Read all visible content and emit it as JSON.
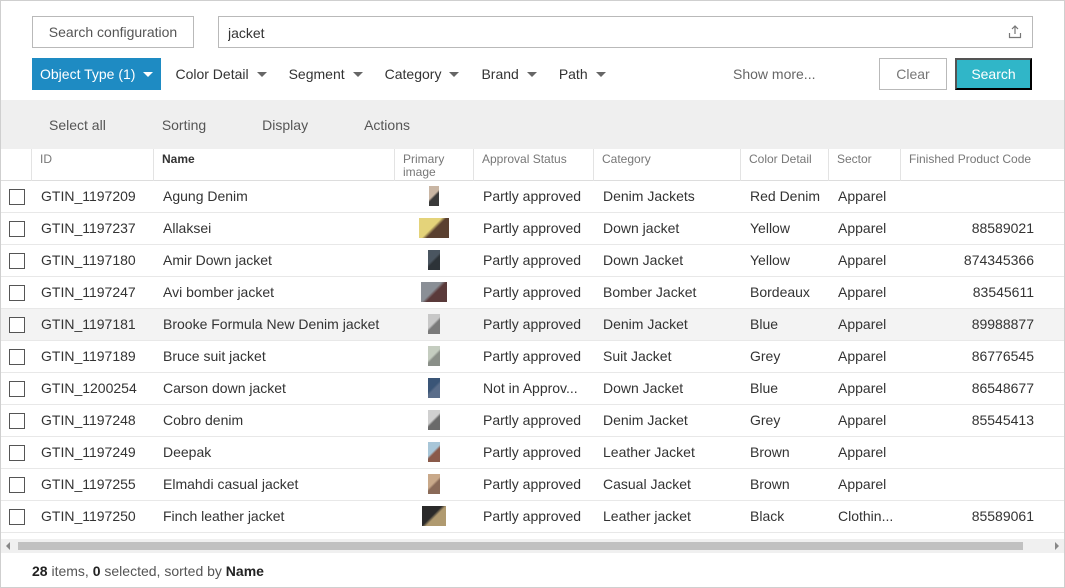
{
  "search": {
    "config_button": "Search configuration",
    "query": "jacket"
  },
  "filters": [
    {
      "label": "Object Type (1)",
      "active": true
    },
    {
      "label": "Color Detail",
      "active": false
    },
    {
      "label": "Segment",
      "active": false
    },
    {
      "label": "Category",
      "active": false
    },
    {
      "label": "Brand",
      "active": false
    },
    {
      "label": "Path",
      "active": false
    }
  ],
  "show_more": "Show more...",
  "clear_label": "Clear",
  "search_label": "Search",
  "toolbar": {
    "select_all": "Select all",
    "sorting": "Sorting",
    "display": "Display",
    "actions": "Actions"
  },
  "columns": [
    "ID",
    "Name",
    "Primary image",
    "Approval Status",
    "Category",
    "Color Detail",
    "Sector",
    "Finished Product Code"
  ],
  "rows": [
    {
      "id": "GTIN_1197209",
      "name": "Agung Denim",
      "status": "Partly approved",
      "category": "Denim Jackets",
      "color": "Red Denim",
      "sector": "Apparel",
      "code": "",
      "img": [
        "#c9b6a4",
        "#3a3a3a"
      ]
    },
    {
      "id": "GTIN_1197237",
      "name": "Allaksei",
      "status": "Partly approved",
      "category": "Down jacket",
      "color": "Yellow",
      "sector": "Apparel",
      "code": "88589021",
      "img": [
        "#e4d37a",
        "#5a4030"
      ]
    },
    {
      "id": "GTIN_1197180",
      "name": "Amir Down jacket",
      "status": "Partly approved",
      "category": "Down Jacket",
      "color": "Yellow",
      "sector": "Apparel",
      "code": "874345366",
      "img": [
        "#4a5560",
        "#2d3338"
      ]
    },
    {
      "id": "GTIN_1197247",
      "name": "Avi bomber jacket",
      "status": "Partly approved",
      "category": "Bomber Jacket",
      "color": "Bordeaux",
      "sector": "Apparel",
      "code": "83545611",
      "img": [
        "#8a8f96",
        "#5a3a3a"
      ]
    },
    {
      "id": "GTIN_1197181",
      "name": "Brooke Formula New Denim jacket",
      "status": "Partly approved",
      "category": "Denim Jacket",
      "color": "Blue",
      "sector": "Apparel",
      "code": "89988877",
      "img": [
        "#c8c8c8",
        "#7a7a7a"
      ]
    },
    {
      "id": "GTIN_1197189",
      "name": "Bruce suit jacket",
      "status": "Partly approved",
      "category": "Suit Jacket",
      "color": "Grey",
      "sector": "Apparel",
      "code": "86776545",
      "img": [
        "#c5cdc0",
        "#8a8f88"
      ]
    },
    {
      "id": "GTIN_1200254",
      "name": "Carson down jacket",
      "status": "Not in Approv...",
      "category": "Down Jacket",
      "color": "Blue",
      "sector": "Apparel",
      "code": "86548677",
      "img": [
        "#3a5577",
        "#5a6d8a"
      ]
    },
    {
      "id": "GTIN_1197248",
      "name": "Cobro denim",
      "status": "Partly approved",
      "category": "Denim Jacket",
      "color": "Grey",
      "sector": "Apparel",
      "code": "85545413",
      "img": [
        "#d0d0d0",
        "#6a6a6a"
      ]
    },
    {
      "id": "GTIN_1197249",
      "name": "Deepak",
      "status": "Partly approved",
      "category": "Leather Jacket",
      "color": "Brown",
      "sector": "Apparel",
      "code": "",
      "img": [
        "#a8c6d8",
        "#8a5a4a"
      ]
    },
    {
      "id": "GTIN_1197255",
      "name": "Elmahdi casual jacket",
      "status": "Partly approved",
      "category": "Casual Jacket",
      "color": "Brown",
      "sector": "Apparel",
      "code": "",
      "img": [
        "#c9a98a",
        "#8a6a58"
      ]
    },
    {
      "id": "GTIN_1197250",
      "name": "Finch leather jacket",
      "status": "Partly approved",
      "category": "Leather jacket",
      "color": "Black",
      "sector": "Clothin...",
      "code": "85589061",
      "img": [
        "#2a2a2a",
        "#b09a70"
      ]
    }
  ],
  "footer": {
    "count": "28",
    "items_text": "items,",
    "selected": "0",
    "selected_text": "selected, sorted by",
    "sort_field": "Name"
  },
  "colors": {
    "accent": "#1e8bc3",
    "search_button": "#30b6c8",
    "toolbar_bg": "#efefef"
  },
  "icons": {
    "upload": "upload-icon",
    "checkbox": "checkbox-icon",
    "dropdown": "caret-down-icon"
  }
}
